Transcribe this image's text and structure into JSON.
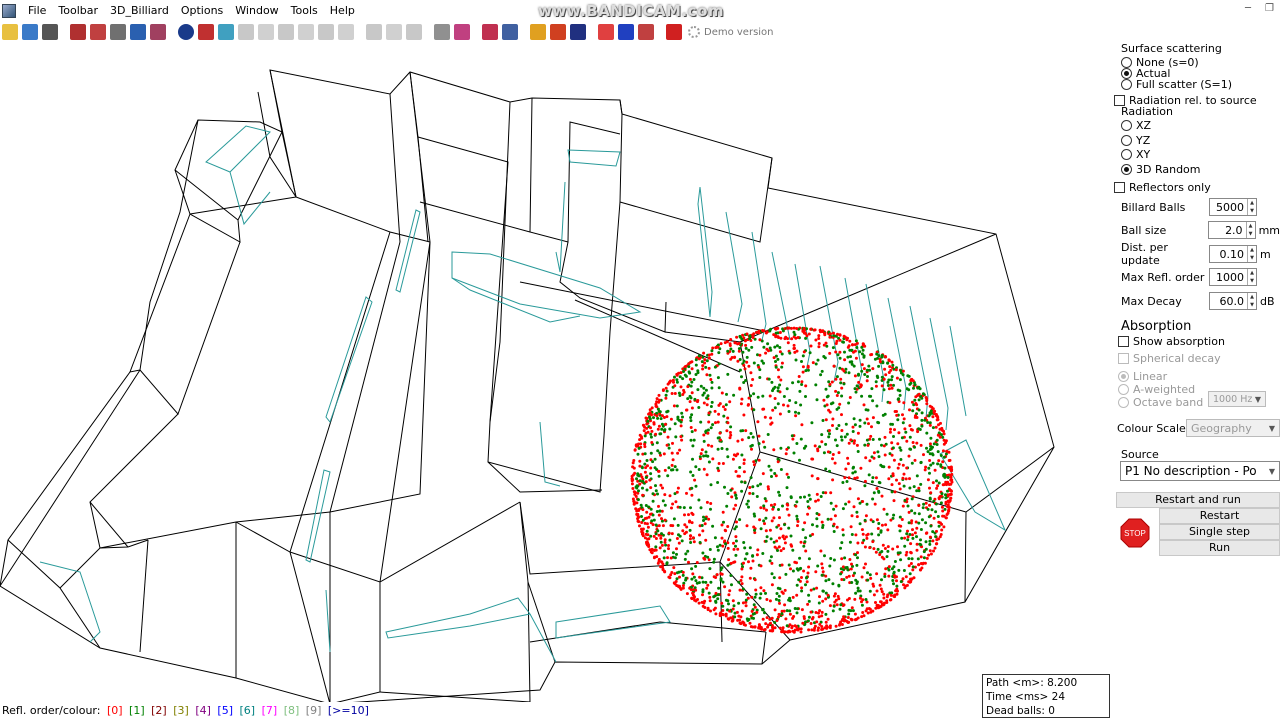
{
  "menu": {
    "items": [
      "File",
      "Toolbar",
      "3D_Billiard",
      "Options",
      "Window",
      "Tools",
      "Help"
    ]
  },
  "watermark": "www.BANDICAM.com",
  "toolbar": {
    "demo_version": "Demo version"
  },
  "panel": {
    "surface_scattering": {
      "title": "Surface scattering",
      "options": [
        {
          "label": "None (s=0)",
          "selected": false
        },
        {
          "label": "Actual",
          "selected": true
        },
        {
          "label": "Full scatter (S=1)",
          "selected": false
        }
      ]
    },
    "radiation_rel_source": {
      "label": "Radiation rel. to source",
      "checked": false
    },
    "radiation": {
      "title": "Radiation",
      "options": [
        {
          "label": "XZ",
          "selected": false
        },
        {
          "label": "YZ",
          "selected": false
        },
        {
          "label": "XY",
          "selected": false
        },
        {
          "label": "3D Random",
          "selected": true
        }
      ]
    },
    "reflectors_only": {
      "label": "Reflectors only",
      "checked": false
    },
    "fields": [
      {
        "label": "Billard Balls",
        "value": "5000",
        "unit": ""
      },
      {
        "label": "Ball size",
        "value": "2.0",
        "unit": "mm"
      },
      {
        "label": "Dist. per update",
        "value": "0.10",
        "unit": "m"
      },
      {
        "label": "Max Refl. order",
        "value": "1000",
        "unit": ""
      },
      {
        "label": "Max Decay",
        "value": "60.0",
        "unit": "dB"
      }
    ],
    "absorption": {
      "title": "Absorption",
      "show_absorption": {
        "label": "Show absorption",
        "checked": false
      },
      "spherical_decay": {
        "label": "Spherical decay",
        "checked": false
      },
      "options": [
        {
          "label": "Linear",
          "selected": true
        },
        {
          "label": "A-weighted",
          "selected": false
        },
        {
          "label": "Octave band",
          "selected": false
        }
      ],
      "band": "1000 Hz"
    },
    "colour_scale": {
      "label": "Colour Scale",
      "value": "Geography"
    },
    "source": {
      "title": "Source",
      "value": "P1 No description  -  Po"
    },
    "buttons": {
      "restart_and_run": "Restart and run",
      "restart": "Restart",
      "single_step": "Single step",
      "run": "Run",
      "stop": "STOP"
    }
  },
  "status": {
    "path": "Path <m>:  8.200",
    "time": "Time <ms> 24",
    "dead_balls": "Dead balls:  0"
  },
  "legend": {
    "label": "Refl. order/colour:",
    "items": [
      {
        "text": "[0]",
        "color": "#ff0000"
      },
      {
        "text": "[1]",
        "color": "#008000"
      },
      {
        "text": "[2]",
        "color": "#800000"
      },
      {
        "text": "[3]",
        "color": "#808000"
      },
      {
        "text": "[4]",
        "color": "#800080"
      },
      {
        "text": "[5]",
        "color": "#0000ff"
      },
      {
        "text": "[6]",
        "color": "#008080"
      },
      {
        "text": "[7]",
        "color": "#ff00ff"
      },
      {
        "text": "[8]",
        "color": "#80c080"
      },
      {
        "text": "[9]",
        "color": "#808080"
      },
      {
        "text": "[>=10]",
        "color": "#0000a0"
      }
    ]
  },
  "colors": {
    "wire": "#000000",
    "reflector": "#2a9a9a",
    "ball_order0": "#ff0000",
    "ball_order1": "#008000"
  }
}
